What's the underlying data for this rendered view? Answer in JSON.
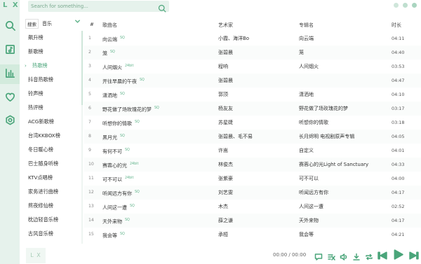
{
  "app": {
    "logo": "L X",
    "player_logo": "L X"
  },
  "colors": {
    "accent": "#4aa57a",
    "rail": "#e6f2ec"
  },
  "search": {
    "placeholder": "Search for something..."
  },
  "source": {
    "tooltip": "搜索",
    "name": "音乐"
  },
  "nav": [
    {
      "name": "search-icon"
    },
    {
      "name": "music-library-icon"
    },
    {
      "name": "leaderboard-icon",
      "active": true
    },
    {
      "name": "heart-icon"
    },
    {
      "name": "settings-icon"
    }
  ],
  "leaderboards": [
    {
      "label": "飙升榜"
    },
    {
      "label": "新歌榜"
    },
    {
      "label": "热歌榜",
      "active": true
    },
    {
      "label": "抖音热歌榜"
    },
    {
      "label": "铃声榜"
    },
    {
      "label": "热评榜"
    },
    {
      "label": "ACG新歌榜"
    },
    {
      "label": "台湾KKBOX榜"
    },
    {
      "label": "冬日暖心榜"
    },
    {
      "label": "巴士随身听榜"
    },
    {
      "label": "KTV点唱榜"
    },
    {
      "label": "家务进行曲榜"
    },
    {
      "label": "熬夜修仙榜"
    },
    {
      "label": "枕边轻音乐榜"
    },
    {
      "label": "古风音乐榜"
    }
  ],
  "table": {
    "headers": {
      "index": "#",
      "name": "歌曲名",
      "artist": "艺术家",
      "album": "专辑名",
      "duration": "时长"
    },
    "rows": [
      {
        "num": "1",
        "name": "向云端",
        "quality": "SQ",
        "artist": "小霞、海洋Bo",
        "album": "向云端",
        "duration": "04:11"
      },
      {
        "num": "2",
        "name": "笼",
        "quality": "SQ",
        "artist": "张碧晨",
        "album": "笼",
        "duration": "04:40"
      },
      {
        "num": "3",
        "name": "人间烟火",
        "quality": "24bit",
        "artist": "程响",
        "album": "人间烟火",
        "duration": "03:53"
      },
      {
        "num": "4",
        "name": "开往早晨的午夜",
        "quality": "SQ",
        "artist": "张碧晨",
        "album": "",
        "duration": "04:47"
      },
      {
        "num": "5",
        "name": "潇洒地",
        "quality": "SQ",
        "artist": "郭顶",
        "album": "潇洒地",
        "duration": "04:10"
      },
      {
        "num": "6",
        "name": "野花做了场玫瑰花的梦",
        "quality": "SQ",
        "artist": "杨友友",
        "album": "野花做了场玫瑰花的梦",
        "duration": "03:17"
      },
      {
        "num": "7",
        "name": "听想你的情歌",
        "quality": "SQ",
        "artist": "苏星婕",
        "album": "听想你的情歌",
        "duration": "03:18"
      },
      {
        "num": "8",
        "name": "黑月光",
        "quality": "SQ",
        "artist": "张碧晨、毛不易",
        "album": "长月烬明 电视剧原声专辑",
        "duration": "04:05"
      },
      {
        "num": "9",
        "name": "有何不可",
        "quality": "SQ",
        "artist": "许嵩",
        "album": "自定义",
        "duration": "04:01"
      },
      {
        "num": "10",
        "name": "赛蓉心的光",
        "quality": "24bit",
        "artist": "林俊杰",
        "album": "赛蓉心的光Light of Sanctuary",
        "duration": "04:33"
      },
      {
        "num": "11",
        "name": "可不可以",
        "quality": "24bit",
        "artist": "张紫豪",
        "album": "可不可以",
        "duration": "04:00"
      },
      {
        "num": "12",
        "name": "听闻远方有你",
        "quality": "SQ",
        "artist": "刘艺雯",
        "album": "听闻远方有你",
        "duration": "04:17"
      },
      {
        "num": "13",
        "name": "人间这一遭",
        "quality": "SQ",
        "artist": "木杰",
        "album": "人间这一遭",
        "duration": "02:52"
      },
      {
        "num": "14",
        "name": "天外来物",
        "quality": "SQ",
        "artist": "薛之谦",
        "album": "天外来物",
        "duration": "04:17"
      },
      {
        "num": "15",
        "name": "我会等",
        "quality": "SQ",
        "artist": "承桓",
        "album": "我会等",
        "duration": "04:21"
      }
    ]
  },
  "player": {
    "time": "00:00 / 00:00"
  }
}
